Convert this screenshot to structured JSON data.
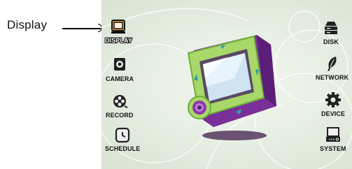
{
  "callout": {
    "label": "Display"
  },
  "menu": {
    "left": [
      {
        "label": "DISPLAY",
        "icon": "display-icon",
        "selected": true
      },
      {
        "label": "CAMERA",
        "icon": "camera-icon",
        "selected": false
      },
      {
        "label": "RECORD",
        "icon": "record-icon",
        "selected": false
      },
      {
        "label": "SCHEDULE",
        "icon": "schedule-icon",
        "selected": false
      }
    ],
    "right": [
      {
        "label": "DISK",
        "icon": "disk-icon",
        "selected": false
      },
      {
        "label": "NETWORK",
        "icon": "network-icon",
        "selected": false
      },
      {
        "label": "DEVICE",
        "icon": "device-icon",
        "selected": false
      },
      {
        "label": "SYSTEM",
        "icon": "system-icon",
        "selected": false
      }
    ]
  },
  "colors": {
    "accent_orange": "#e88a1c",
    "illustration_green": "#a8d86a",
    "illustration_purple": "#8a3aa8",
    "panel_background": "#e5ede1"
  }
}
